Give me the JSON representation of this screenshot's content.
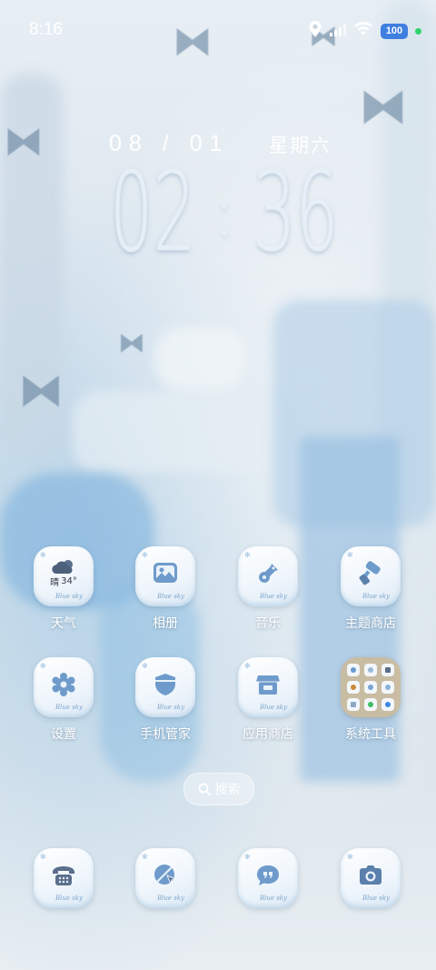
{
  "status_bar": {
    "time": "8:16",
    "battery": "100",
    "icons": [
      "location-icon",
      "signal-icon",
      "wifi-icon",
      "battery-icon",
      "green-dot"
    ]
  },
  "clock_widget": {
    "date": "08 / 01",
    "weekday": "星期六",
    "hour": "02",
    "minute": "36"
  },
  "weather": {
    "condition": "晴",
    "temperature": "34°"
  },
  "apps_row1": [
    {
      "label": "天气",
      "icon": "weather-icon"
    },
    {
      "label": "相册",
      "icon": "gallery-icon"
    },
    {
      "label": "音乐",
      "icon": "music-icon"
    },
    {
      "label": "主题商店",
      "icon": "theme-store-icon"
    }
  ],
  "apps_row2": [
    {
      "label": "设置",
      "icon": "settings-icon"
    },
    {
      "label": "手机管家",
      "icon": "phone-manager-icon"
    },
    {
      "label": "应用商店",
      "icon": "app-store-icon"
    },
    {
      "label": "系统工具",
      "icon": "folder-icon"
    }
  ],
  "search": {
    "label": "搜索"
  },
  "dock": [
    {
      "icon": "phone-icon"
    },
    {
      "icon": "browser-icon"
    },
    {
      "icon": "messages-icon"
    },
    {
      "icon": "camera-icon"
    }
  ],
  "icon_deco_text": "Blue sky",
  "colors": {
    "accent": "#3e7fe0",
    "icon_blue": "#6e9bcb",
    "label_text": "#ffffff"
  }
}
